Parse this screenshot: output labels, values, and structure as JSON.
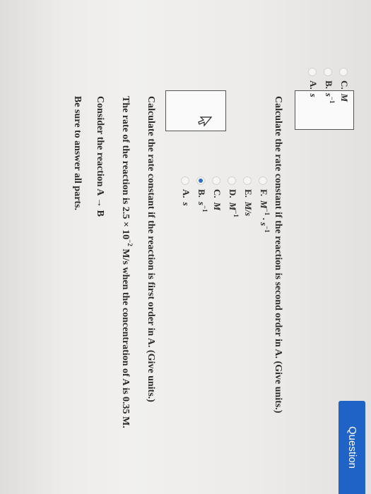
{
  "header": {
    "question_tab_label": "Question"
  },
  "instructions": "Be sure to answer all parts.",
  "reaction_line": "Consider the reaction A → B",
  "rate_statement": {
    "part1": "The rate of the reaction is 2.5 × 10",
    "exp": "−2",
    "part2": " M/s when the concentration of A is 0.35 M."
  },
  "part_a": {
    "prompt": "Calculate the rate constant if the reaction is first order in A. (Give units.)",
    "answer_value": "",
    "options": [
      {
        "letter": "A.",
        "unit": "s",
        "sup": "",
        "selected": false
      },
      {
        "letter": "B.",
        "unit": "s",
        "sup": "−1",
        "selected": true
      },
      {
        "letter": "C.",
        "unit": "M",
        "sup": "",
        "selected": false
      },
      {
        "letter": "D.",
        "unit": "M",
        "sup": "−1",
        "selected": false
      },
      {
        "letter": "E.",
        "unit": "M/s",
        "sup": "",
        "selected": false
      },
      {
        "letter": "F.",
        "unit": "M",
        "sup": "−1",
        "extra_unit": " · s",
        "extra_sup": "−1",
        "selected": false
      }
    ]
  },
  "part_b": {
    "prompt": "Calculate the rate constant if the reaction is second order in A. (Give units.)",
    "answer_value": "",
    "options": [
      {
        "letter": "A.",
        "unit": "s",
        "sup": "",
        "selected": false
      },
      {
        "letter": "B.",
        "unit": "s",
        "sup": "−1",
        "selected": false
      },
      {
        "letter": "C.",
        "unit": "M",
        "sup": "",
        "selected": false
      }
    ]
  }
}
